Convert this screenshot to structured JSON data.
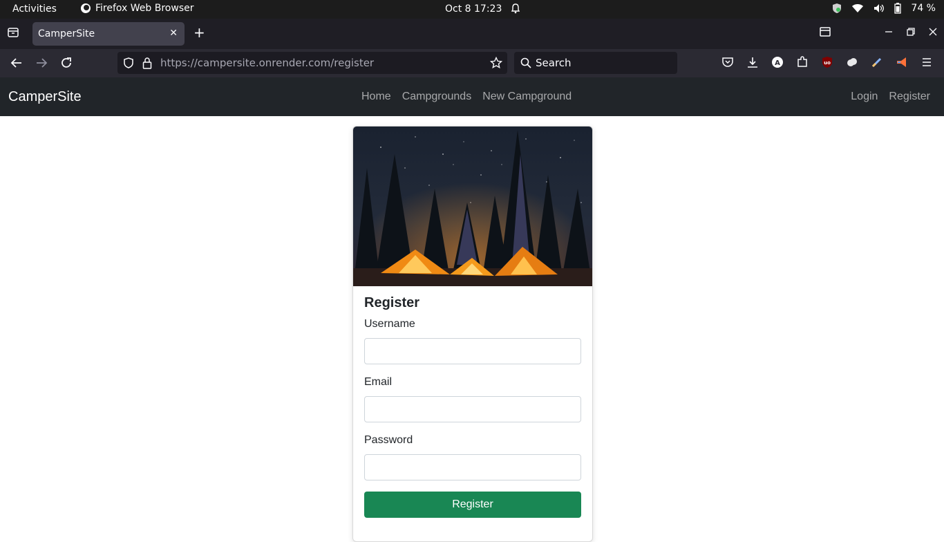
{
  "system_bar": {
    "activities": "Activities",
    "app_name": "Firefox Web Browser",
    "datetime": "Oct 8  17:23",
    "battery": "74 %"
  },
  "browser": {
    "tab_title": "CamperSite",
    "url_host": "https://campersite.onrender.com",
    "url_path": "/register",
    "search_placeholder": "Search"
  },
  "site": {
    "brand": "CamperSite",
    "nav_links": [
      "Home",
      "Campgrounds",
      "New Campground"
    ],
    "auth_links": [
      "Login",
      "Register"
    ]
  },
  "register_form": {
    "title": "Register",
    "username_label": "Username",
    "email_label": "Email",
    "password_label": "Password",
    "submit_label": "Register",
    "username_value": "",
    "email_value": "",
    "password_value": ""
  },
  "colors": {
    "site_nav_bg": "#212529",
    "submit_button": "#198754"
  }
}
